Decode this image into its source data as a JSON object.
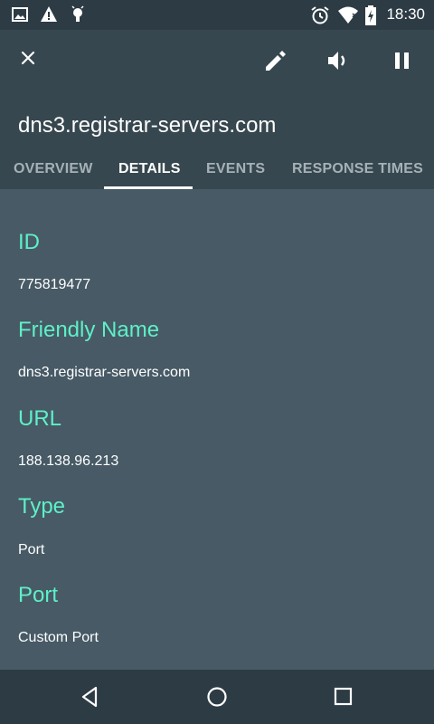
{
  "status_bar": {
    "time": "18:30",
    "left_icons": [
      "image-icon",
      "warning-icon",
      "android-debug-icon"
    ],
    "right_icons": [
      "alarm-icon",
      "wifi-icon",
      "battery-charging-icon"
    ]
  },
  "app_bar": {
    "title": "dns3.registrar-servers.com",
    "actions": [
      "close-icon",
      "edit-icon",
      "volume-icon",
      "pause-icon"
    ]
  },
  "tabs": [
    {
      "label": "OVERVIEW",
      "active": false
    },
    {
      "label": "DETAILS",
      "active": true
    },
    {
      "label": "EVENTS",
      "active": false
    },
    {
      "label": "RESPONSE TIMES",
      "active": false
    }
  ],
  "details": {
    "id_label": "ID",
    "id_value": "775819477",
    "friendly_name_label": "Friendly Name",
    "friendly_name_value": "dns3.registrar-servers.com",
    "url_label": "URL",
    "url_value": "188.138.96.213",
    "type_label": "Type",
    "type_value": "Port",
    "port_label": "Port",
    "port_value": "Custom Port"
  },
  "nav_bar": {
    "buttons": [
      "back-icon",
      "home-icon",
      "recent-apps-icon"
    ]
  },
  "colors": {
    "status_bar_bg": "#2d3b44",
    "app_bar_bg": "#37474f",
    "content_bg": "#475a66",
    "label_accent": "#5ef0c8",
    "inactive_tab": "#a6b1b7"
  }
}
